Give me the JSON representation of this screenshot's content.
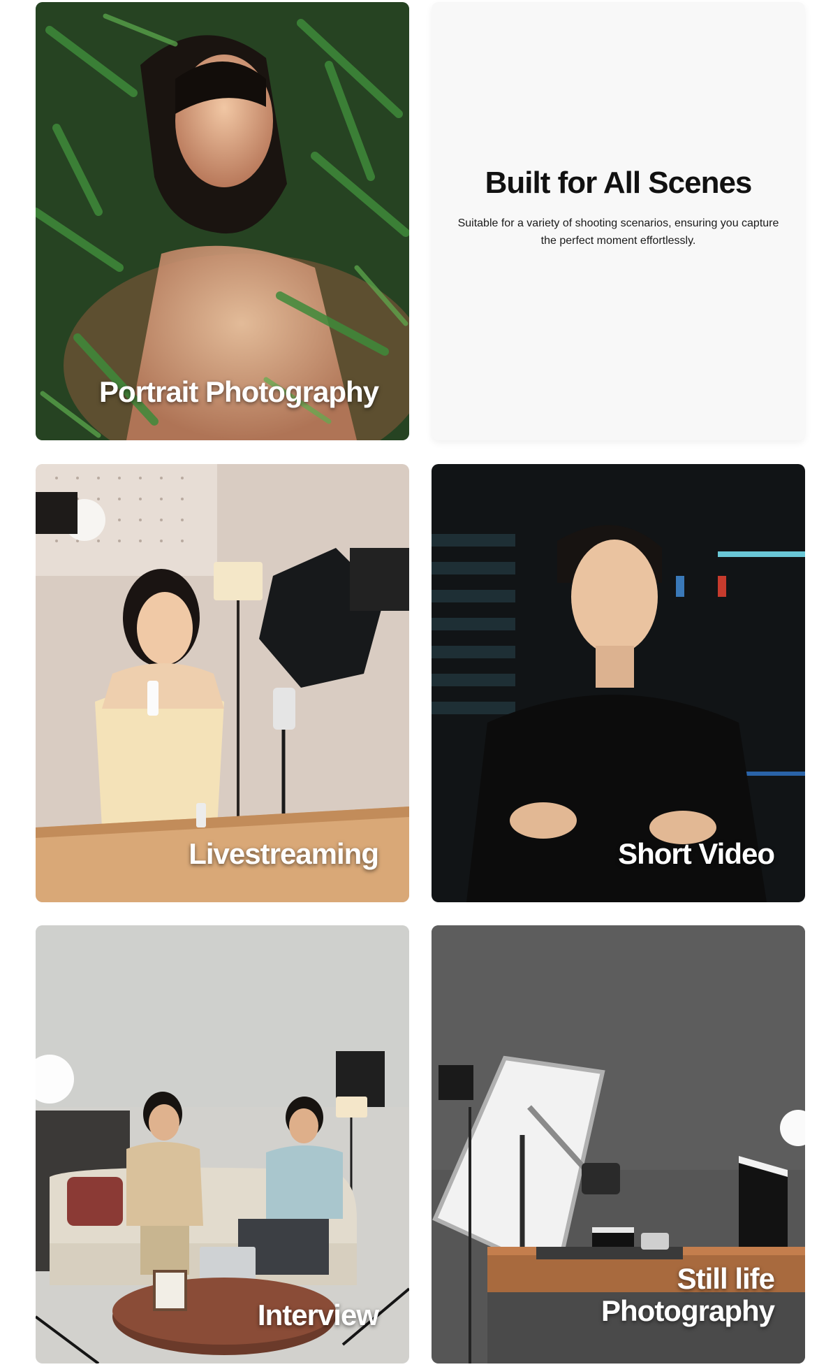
{
  "intro": {
    "title": "Built for All Scenes",
    "subtitle": "Suitable for a variety of shooting scenarios, ensuring you capture the perfect moment effortlessly."
  },
  "scenes": [
    {
      "label": "Portrait Photography",
      "icon": "portrait-photo"
    },
    {
      "label": "Livestreaming",
      "icon": "livestream-photo"
    },
    {
      "label": "Short Video",
      "icon": "short-video-photo"
    },
    {
      "label": "Interview",
      "icon": "interview-photo"
    },
    {
      "label": "Still life Photography",
      "icon": "still-life-photo"
    }
  ],
  "colors": {
    "intro_background": "#f8f8f8",
    "label_text": "#ffffff",
    "title_text": "#111111"
  }
}
